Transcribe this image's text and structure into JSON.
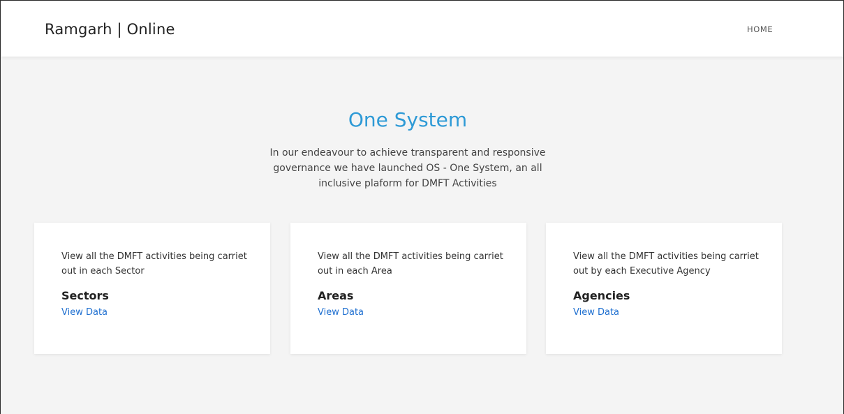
{
  "navbar": {
    "brand": "Ramgarh | Online",
    "home_label": "HOME"
  },
  "hero": {
    "title": "One System",
    "description": "In our endeavour to achieve transparent and responsive governance we have launched OS - One System, an all inclusive plaform for DMFT Activities"
  },
  "cards": [
    {
      "description": "View all the DMFT activities being carriet out in each Sector",
      "title": "Sectors",
      "link_label": "View Data"
    },
    {
      "description": "View all the DMFT activities being carriet out in each Area",
      "title": "Areas",
      "link_label": "View Data"
    },
    {
      "description": "View all the DMFT activities being carriet out by each Executive Agency",
      "title": "Agencies",
      "link_label": "View Data"
    }
  ],
  "colors": {
    "accent_title": "#2e9ad6",
    "link": "#1e6fd0",
    "background": "#f4f4f4"
  }
}
